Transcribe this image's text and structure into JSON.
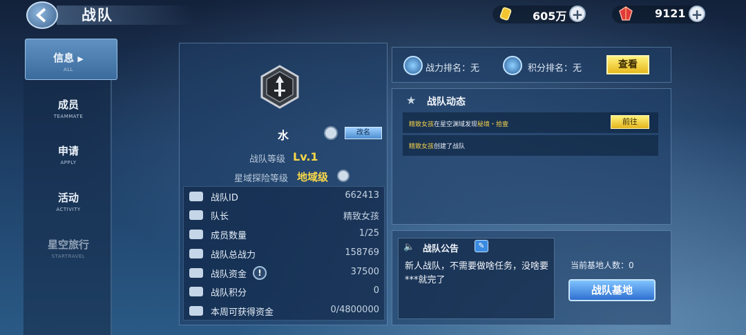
{
  "header": {
    "title": "战队",
    "gold": "605万",
    "gems": "9121"
  },
  "nav": [
    {
      "zh": "信息",
      "en": "ALL"
    },
    {
      "zh": "成员",
      "en": "TEAMMATE"
    },
    {
      "zh": "申请",
      "en": "APPLY"
    },
    {
      "zh": "活动",
      "en": "ACTIVITY"
    },
    {
      "zh": "星空旅行",
      "en": "STARTRAVEL"
    }
  ],
  "team": {
    "name": "水",
    "rename_label": "改名",
    "level_label": "战队等级",
    "level_value": "Lv.1",
    "explore_label": "星域探险等级",
    "explore_value": "地域级"
  },
  "stats": [
    {
      "label": "战队ID",
      "value": "662413"
    },
    {
      "label": "队长",
      "value": "精致女孩"
    },
    {
      "label": "成员数量",
      "value": "1/25"
    },
    {
      "label": "战队总战力",
      "value": "158769"
    },
    {
      "label": "战队资金",
      "value": "37500"
    },
    {
      "label": "战队积分",
      "value": "0"
    },
    {
      "label": "本周可获得资金",
      "value": "0/4800000"
    }
  ],
  "rank": {
    "power_label": "战力排名：无",
    "score_label": "积分排名：无",
    "view_button": "查看"
  },
  "news": {
    "title": "战队动态",
    "item1_name": "精致女孩",
    "item1_mid": "在星空渊域发现",
    "item1_hl": "秘境・拾壹",
    "item1_button": "前往",
    "item2_name": "精致女孩",
    "item2_rest": "创建了战队"
  },
  "notice": {
    "title": "战队公告",
    "text": "新人战队，不需要做啥任务，没啥要***就完了"
  },
  "base": {
    "count_label": "当前基地人数：0",
    "button": "战队基地"
  }
}
